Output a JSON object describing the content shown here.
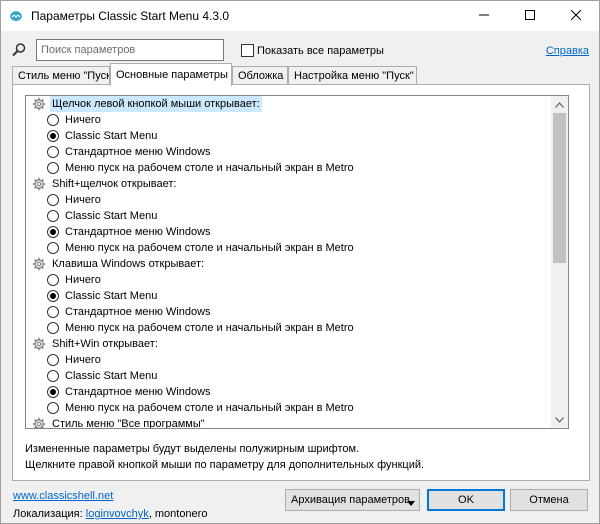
{
  "window": {
    "title": "Параметры Classic Start Menu 4.3.0",
    "icons": {
      "app": "shell-app-icon",
      "minimize": "minimize-icon",
      "maximize": "maximize-icon",
      "close": "close-icon"
    }
  },
  "search": {
    "placeholder": "Поиск параметров",
    "value": "",
    "show_all_label": "Показать все параметры",
    "show_all_checked": false,
    "help_link": "Справка"
  },
  "tabs": [
    {
      "label": "Стиль меню \"Пуск\"",
      "active": false
    },
    {
      "label": "Основные параметры",
      "active": true
    },
    {
      "label": "Обложка",
      "active": false
    },
    {
      "label": "Настройка меню \"Пуск\"",
      "active": false
    }
  ],
  "settings": {
    "groups": [
      {
        "label": "Щелчок левой кнопкой мыши открывает:",
        "selected": true,
        "options": [
          {
            "label": "Ничего",
            "checked": false
          },
          {
            "label": "Classic Start Menu",
            "checked": true
          },
          {
            "label": "Стандартное меню Windows",
            "checked": false
          },
          {
            "label": "Меню пуск на рабочем столе и начальный экран в Metro",
            "checked": false
          }
        ]
      },
      {
        "label": "Shift+щелчок открывает:",
        "selected": false,
        "options": [
          {
            "label": "Ничего",
            "checked": false
          },
          {
            "label": "Classic Start Menu",
            "checked": false
          },
          {
            "label": "Стандартное меню Windows",
            "checked": true
          },
          {
            "label": "Меню пуск на рабочем столе и начальный экран в Metro",
            "checked": false
          }
        ]
      },
      {
        "label": "Клавиша Windows открывает:",
        "selected": false,
        "options": [
          {
            "label": "Ничего",
            "checked": false
          },
          {
            "label": "Classic Start Menu",
            "checked": true
          },
          {
            "label": "Стандартное меню Windows",
            "checked": false
          },
          {
            "label": "Меню пуск на рабочем столе и начальный экран в Metro",
            "checked": false
          }
        ]
      },
      {
        "label": "Shift+Win открывает:",
        "selected": false,
        "options": [
          {
            "label": "Ничего",
            "checked": false
          },
          {
            "label": "Classic Start Menu",
            "checked": false
          },
          {
            "label": "Стандартное меню Windows",
            "checked": true
          },
          {
            "label": "Меню пуск на рабочем столе и начальный экран в Metro",
            "checked": false
          }
        ]
      },
      {
        "label": "Стиль меню \"Все программы\"",
        "selected": false,
        "options": []
      }
    ]
  },
  "notes": {
    "line1": "Измененные параметры будут выделены полужирным шрифтом.",
    "line2": "Щелкните правой кнопкой мыши по параметру для дополнительных функций."
  },
  "footer": {
    "website": "www.classicshell.net",
    "localization_label": "Локализация:",
    "localization_author": "loginvovchyk",
    "localization_rest": ", montonero",
    "archive_button": "Архивация параметров",
    "ok_button": "OK",
    "cancel_button": "Отмена"
  },
  "colors": {
    "selection": "#cce8ff",
    "link": "#0066cc",
    "default_button_border": "#0078d7"
  }
}
